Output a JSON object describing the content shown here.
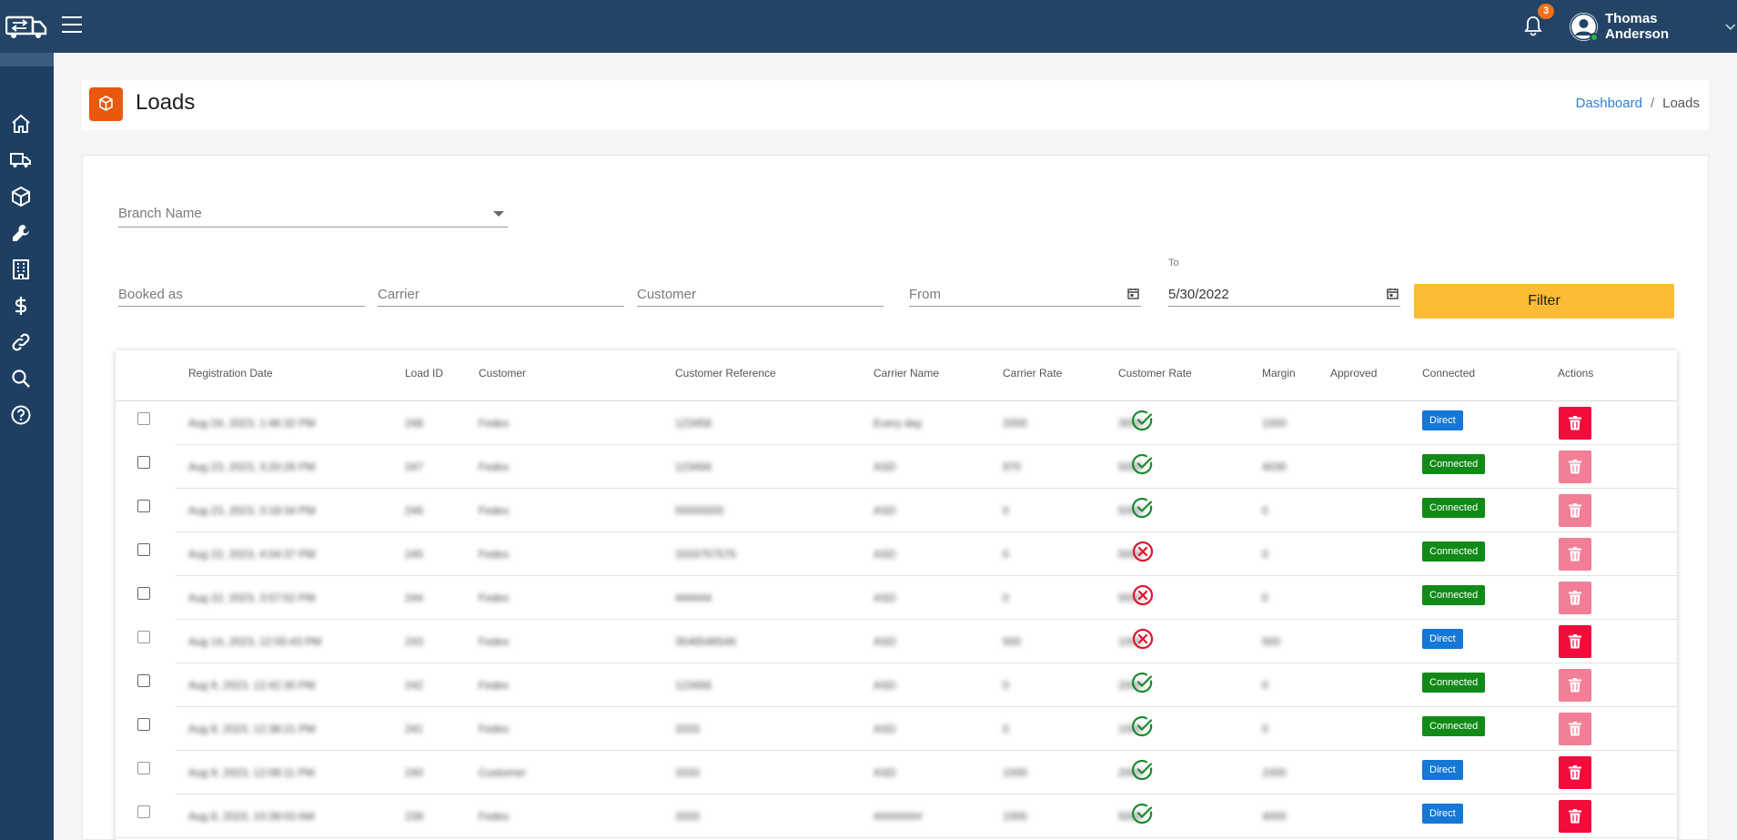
{
  "topbar": {
    "notification_count": "3",
    "user_name": "Thomas Anderson"
  },
  "sidebar": {
    "items": [
      {
        "name": "home"
      },
      {
        "name": "truck"
      },
      {
        "name": "box"
      },
      {
        "name": "wrench"
      },
      {
        "name": "building"
      },
      {
        "name": "dollar"
      },
      {
        "name": "link"
      },
      {
        "name": "search"
      },
      {
        "name": "help"
      }
    ]
  },
  "header": {
    "title": "Loads",
    "breadcrumb_home": "Dashboard",
    "breadcrumb_sep": "/",
    "breadcrumb_current": "Loads"
  },
  "filters": {
    "branch_placeholder": "Branch Name",
    "booked_as_placeholder": "Booked as",
    "carrier_placeholder": "Carrier",
    "customer_placeholder": "Customer",
    "from_placeholder": "From",
    "to_label": "To",
    "to_value": "5/30/2022",
    "filter_button": "Filter"
  },
  "table": {
    "columns": [
      "Registration Date",
      "Load ID",
      "Customer",
      "Customer Reference",
      "Carrier Name",
      "Carrier Rate",
      "Customer Rate",
      "Margin",
      "Approved",
      "Connected",
      "Actions"
    ],
    "rows": [
      {
        "date": "Aug 24, 2023, 1:46:32 PM",
        "id": "248",
        "customer": "Fedex",
        "ref": "123456",
        "carrier": "Every day",
        "carrier_rate": "2000",
        "customer_rate": "3000",
        "margin": "1000",
        "approved": true,
        "connected": "Direct",
        "deletable": true
      },
      {
        "date": "Aug 23, 2023, 3:20:26 PM",
        "id": "247",
        "customer": "Fedex",
        "ref": "123456",
        "carrier": "ASD",
        "carrier_rate": "970",
        "customer_rate": "5000",
        "margin": "4030",
        "approved": true,
        "connected": "Connected",
        "deletable": false
      },
      {
        "date": "Aug 23, 2023, 3:18:34 PM",
        "id": "246",
        "customer": "Fedex",
        "ref": "55555555",
        "carrier": "ASD",
        "carrier_rate": "0",
        "customer_rate": "5000",
        "margin": "0",
        "approved": true,
        "connected": "Connected",
        "deletable": false
      },
      {
        "date": "Aug 22, 2023, 4:04:37 PM",
        "id": "245",
        "customer": "Fedex",
        "ref": "3333757575",
        "carrier": "ASD",
        "carrier_rate": "0",
        "customer_rate": "5000",
        "margin": "0",
        "approved": false,
        "connected": "Connected",
        "deletable": false
      },
      {
        "date": "Aug 22, 2023, 3:57:52 PM",
        "id": "244",
        "customer": "Fedex",
        "ref": "444444",
        "carrier": "ASD",
        "carrier_rate": "0",
        "customer_rate": "5000",
        "margin": "0",
        "approved": false,
        "connected": "Connected",
        "deletable": false
      },
      {
        "date": "Aug 14, 2023, 12:55:43 PM",
        "id": "243",
        "customer": "Fedex",
        "ref": "3546546546",
        "carrier": "ASD",
        "carrier_rate": "500",
        "customer_rate": "1000",
        "margin": "500",
        "approved": false,
        "connected": "Direct",
        "deletable": true
      },
      {
        "date": "Aug 9, 2023, 12:42:30 PM",
        "id": "242",
        "customer": "Fedex",
        "ref": "123456",
        "carrier": "ASD",
        "carrier_rate": "0",
        "customer_rate": "2000",
        "margin": "0",
        "approved": true,
        "connected": "Connected",
        "deletable": false
      },
      {
        "date": "Aug 9, 2023, 12:38:21 PM",
        "id": "241",
        "customer": "Fedex",
        "ref": "3333",
        "carrier": "ASD",
        "carrier_rate": "0",
        "customer_rate": "1000",
        "margin": "0",
        "approved": true,
        "connected": "Connected",
        "deletable": false
      },
      {
        "date": "Aug 9, 2023, 12:08:11 PM",
        "id": "240",
        "customer": "Customer",
        "ref": "3333",
        "carrier": "ASD",
        "carrier_rate": "1000",
        "customer_rate": "2000",
        "margin": "1000",
        "approved": true,
        "connected": "Direct",
        "deletable": true
      },
      {
        "date": "Aug 8, 2023, 10:39:03 AM",
        "id": "239",
        "customer": "Fedex",
        "ref": "3333",
        "carrier": "########",
        "carrier_rate": "1000",
        "customer_rate": "5000",
        "margin": "4000",
        "approved": true,
        "connected": "Direct",
        "deletable": true
      }
    ]
  },
  "colors": {
    "topbar": "#234466",
    "sidebar": "#1e3f61",
    "accent_orange": "#e8580f",
    "filter_button": "#fbbb35",
    "badge_direct": "#1577d6",
    "badge_connected": "#118a17",
    "delete_active": "#f20c3b",
    "delete_disabled": "#f27f96",
    "approved_yes": "#1a8a2e",
    "approved_no": "#e0152f"
  }
}
